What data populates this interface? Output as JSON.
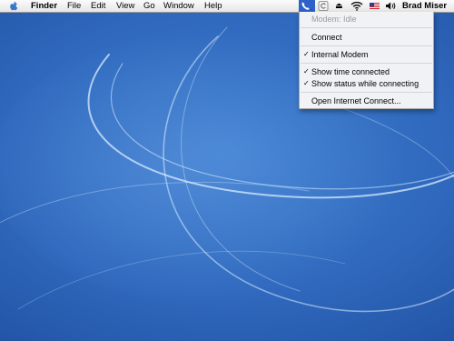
{
  "menubar": {
    "apple_symbol": "",
    "app_name": "Finder",
    "menus": [
      "File",
      "Edit",
      "View",
      "Go",
      "Window",
      "Help"
    ],
    "extras": [
      "phone-icon",
      "sync-icon",
      "eject-icon",
      "wifi-icon",
      "us-flag-icon",
      "volume-icon"
    ],
    "eject_symbol": "⏏",
    "user_name": "Brad Miser",
    "highlight_color": "#2f62c9"
  },
  "modem_menu": {
    "status": "Modem: Idle",
    "connect": "Connect",
    "modem_item": "Internal Modem",
    "modem_checked": true,
    "show_time": "Show time connected",
    "show_time_checked": true,
    "show_status": "Show status while connecting",
    "show_status_checked": true,
    "open_app": "Open Internet Connect...",
    "check_symbol": "✓"
  },
  "desktop": {
    "background_colors": [
      "#3f7fd0",
      "#1f4f9f",
      "#163d84"
    ]
  }
}
